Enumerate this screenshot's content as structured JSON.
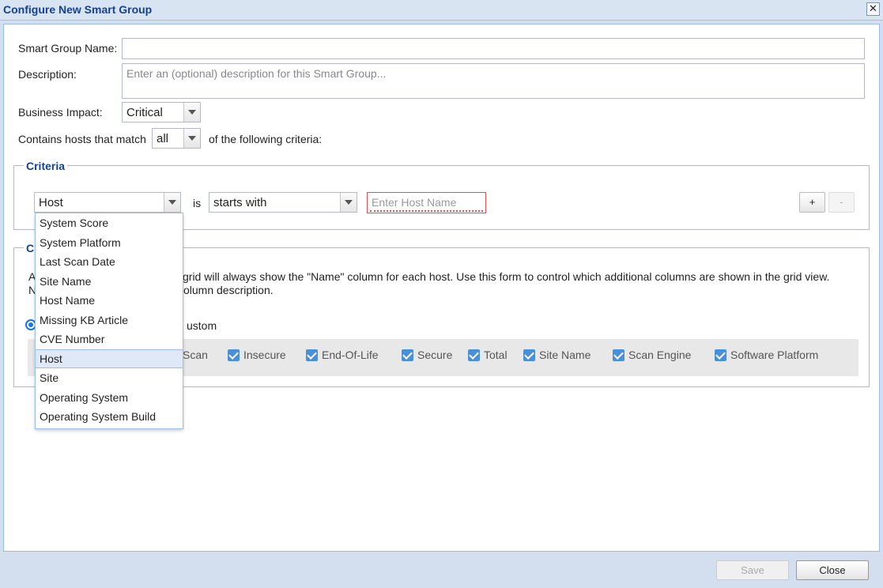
{
  "window": {
    "title": "Configure New Smart Group",
    "close_glyph": "✕"
  },
  "form": {
    "name_label": "Smart Group Name:",
    "name_value": "",
    "description_label": "Description:",
    "description_placeholder": "Enter an (optional) description for this Smart Group...",
    "impact_label": "Business Impact:",
    "impact_value": "Critical",
    "match_label": "Contains hosts that match",
    "match_value": "all",
    "match_suffix": "of the following criteria:"
  },
  "criteria": {
    "legend": "Criteria",
    "field_value": "Host",
    "is_label": "is",
    "operator_value": "starts with",
    "host_placeholder": "Enter Host Name",
    "add_label": "+",
    "remove_label": "-"
  },
  "columns": {
    "legend": "C",
    "description_line1_a": "A",
    "description_line1_b": "grid will always show the \"Name\" column for each host. Use this form to control which additional columns are shown in the grid view.",
    "description_line2_a": "N",
    "description_line2_b": "olumn description.",
    "radio_label": "ustom",
    "checkboxes": [
      {
        "label": "Scan",
        "checked": true
      },
      {
        "label": "Insecure",
        "checked": true
      },
      {
        "label": "End-Of-Life",
        "checked": true
      },
      {
        "label": "Secure",
        "checked": true
      },
      {
        "label": "Total",
        "checked": true
      },
      {
        "label": "Site Name",
        "checked": true
      },
      {
        "label": "Scan Engine",
        "checked": true
      },
      {
        "label": "Software Platform",
        "checked": true
      }
    ]
  },
  "dropdown": {
    "items": [
      "System Score",
      "System Platform",
      "Last Scan Date",
      "Site Name",
      "Host Name",
      "Missing KB Article",
      "CVE Number",
      "Host",
      "Site",
      "Operating System",
      "Operating System Build"
    ],
    "selected": "Host"
  },
  "footer": {
    "save_label": "Save",
    "close_label": "Close"
  },
  "colors": {
    "title": "#15428b",
    "accent": "#4a90d9",
    "invalid": "#e05050"
  }
}
